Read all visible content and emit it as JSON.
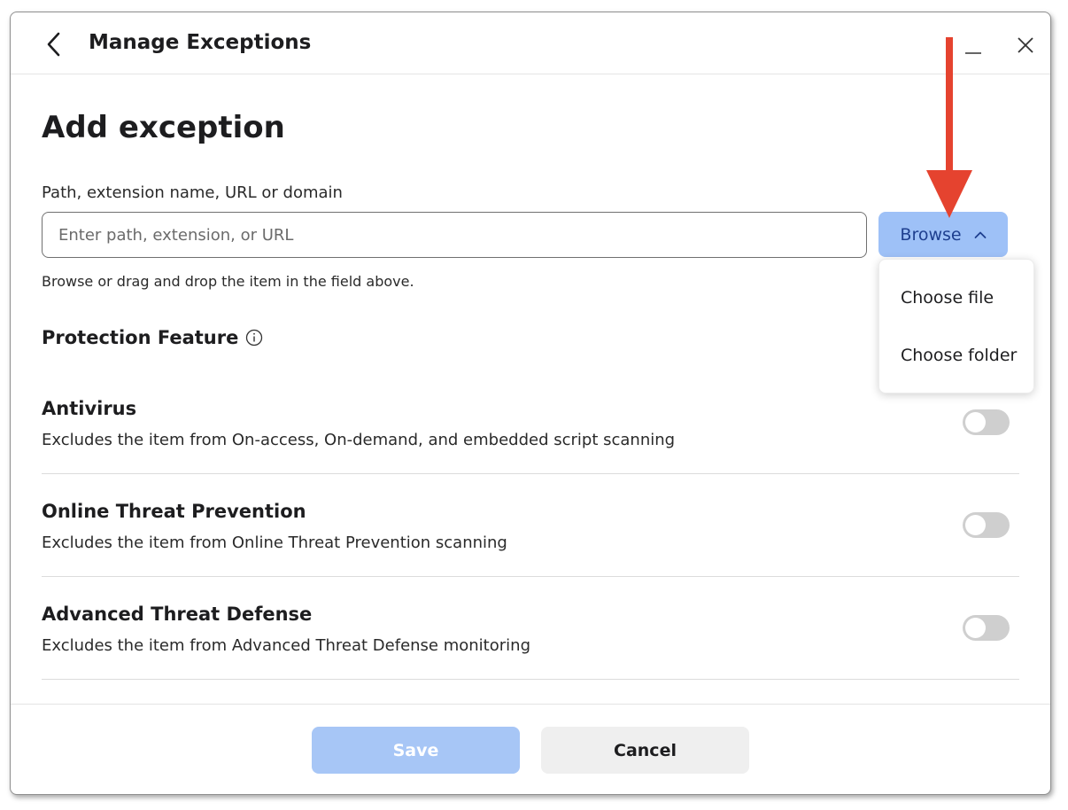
{
  "window": {
    "title": "Manage Exceptions"
  },
  "form": {
    "heading": "Add exception",
    "field_label": "Path, extension name, URL or domain",
    "input_placeholder": "Enter path, extension, or URL",
    "input_value": "",
    "browse_label": "Browse",
    "helper_text": "Browse or drag and drop the item in the field above."
  },
  "browse_menu": {
    "items": [
      "Choose file",
      "Choose folder"
    ]
  },
  "protection": {
    "section_title": "Protection Feature",
    "features": [
      {
        "name": "Antivirus",
        "description": "Excludes the item from On-access, On-demand, and embedded script scanning",
        "enabled": false
      },
      {
        "name": "Online Threat Prevention",
        "description": "Excludes the item from Online Threat Prevention scanning",
        "enabled": false
      },
      {
        "name": "Advanced Threat Defense",
        "description": "Excludes the item from Advanced Threat Defense monitoring",
        "enabled": false
      }
    ]
  },
  "footer": {
    "save_label": "Save",
    "cancel_label": "Cancel"
  },
  "icons": {
    "back": "chevron-left-icon",
    "minimize": "minimize-icon",
    "close": "close-icon",
    "browse_chevron": "chevron-up-icon",
    "info": "info-icon",
    "annotation": "arrow-down-icon"
  },
  "colors": {
    "primary_button": "#9ec1f7",
    "primary_button_text": "#1e3f8f",
    "save_disabled": "#a7c6f6",
    "annotation_arrow": "#e5432f",
    "toggle_off": "#cfcfcf"
  }
}
